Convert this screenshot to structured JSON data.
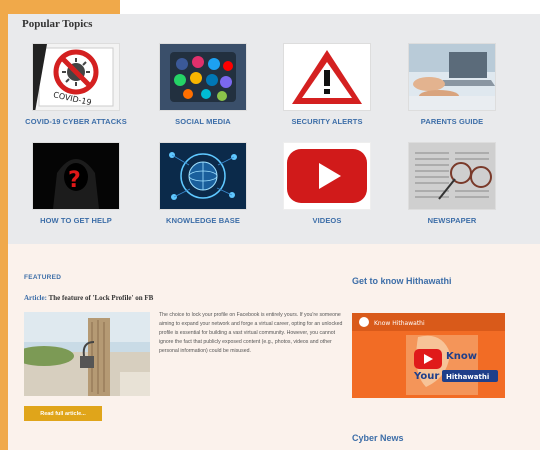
{
  "topics": {
    "title": "Popular Topics",
    "items": [
      {
        "label": "COVID-19 CYBER ATTACKS",
        "icon": "covid-virus-icon"
      },
      {
        "label": "SOCIAL MEDIA",
        "icon": "social-media-icon"
      },
      {
        "label": "SECURITY ALERTS",
        "icon": "warning-icon"
      },
      {
        "label": "PARENTS GUIDE",
        "icon": "laptop-hands-icon"
      },
      {
        "label": "HOW TO GET HELP",
        "icon": "hooded-question-icon"
      },
      {
        "label": "KNOWLEDGE BASE",
        "icon": "tech-globe-icon"
      },
      {
        "label": "VIDEOS",
        "icon": "play-button-icon"
      },
      {
        "label": "NEWSPAPER",
        "icon": "newspaper-glasses-icon"
      }
    ]
  },
  "featured": {
    "heading": "FEATURED",
    "article_prefix": "Article:",
    "article_title": "The feature of 'Lock Profile' on FB",
    "image_icon": "locked-post-icon",
    "excerpt": "The choice to lock your profile on Facebook is entirely yours. If you're someone aiming to expand your network and forge a virtual career, opting for an unlocked profile is essential for building a vast virtual community. However, you cannot ignore the fact that publicly exposed content (e.g., photos, videos and other personal information) could be misused.",
    "button_label": "Read full article..."
  },
  "sidebar": {
    "know_heading": "Get to know Hithawathi",
    "video": {
      "channel": "Know Hithawathi",
      "line1": "Know",
      "line2": "Your",
      "badge": "Hithawathi"
    },
    "cyber_heading": "Cyber News"
  },
  "colors": {
    "accent": "#f0a94a",
    "link_blue": "#3d6ea8",
    "button": "#e0a51a",
    "video_bg": "#f26c25"
  }
}
